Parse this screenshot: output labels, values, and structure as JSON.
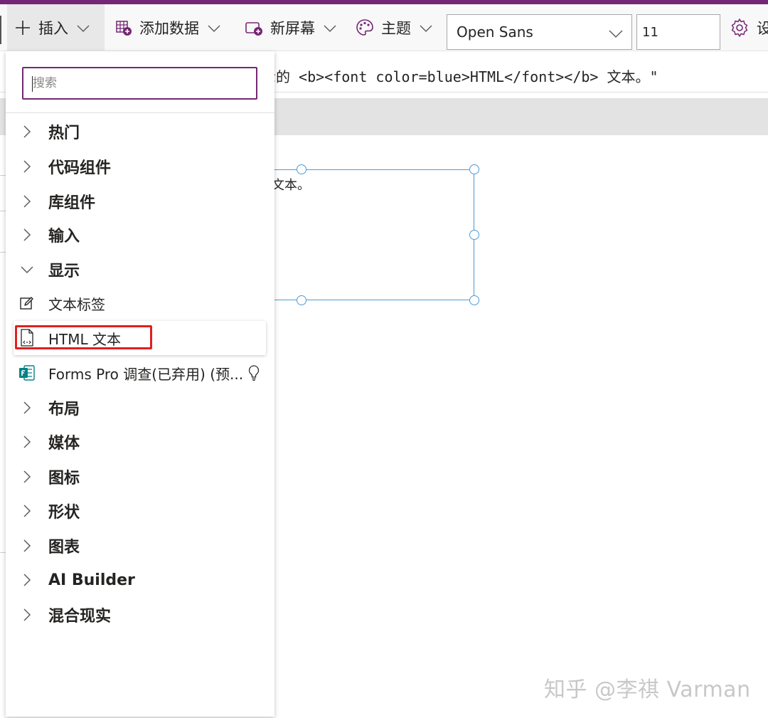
{
  "toolbar": {
    "insert_label": "插入",
    "add_data_label": "添加数据",
    "new_screen_label": "新屏幕",
    "theme_label": "主题",
    "font_value": "Open Sans",
    "font_size_value": "11",
    "settings_label": "设"
  },
  "formula": {
    "text": "示的 <b><font color=blue>HTML</font></b> 文本。\""
  },
  "canvas": {
    "label_text": "文本。"
  },
  "insert_panel": {
    "search_placeholder": "搜索",
    "categories_top": [
      {
        "label": "热门",
        "expanded": false
      },
      {
        "label": "代码组件",
        "expanded": false
      },
      {
        "label": "库组件",
        "expanded": false
      },
      {
        "label": "输入",
        "expanded": false
      },
      {
        "label": "显示",
        "expanded": true
      }
    ],
    "display_items": [
      {
        "label": "文本标签",
        "icon": "edit-label-icon"
      },
      {
        "label": "HTML 文本",
        "icon": "html-document-icon"
      },
      {
        "label": "Forms Pro 调查(已弃用) (预...",
        "icon": "forms-icon"
      }
    ],
    "categories_bottom": [
      {
        "label": "布局"
      },
      {
        "label": "媒体"
      },
      {
        "label": "图标"
      },
      {
        "label": "形状"
      },
      {
        "label": "图表"
      },
      {
        "label": "AI Builder"
      },
      {
        "label": "混合现实"
      }
    ]
  },
  "watermark": {
    "text": "知乎 @李祺 Varman"
  },
  "colors": {
    "brand_purple": "#742774",
    "selection_blue": "#4d9bd6",
    "highlight_red": "#e02020",
    "forms_green": "#038387"
  }
}
